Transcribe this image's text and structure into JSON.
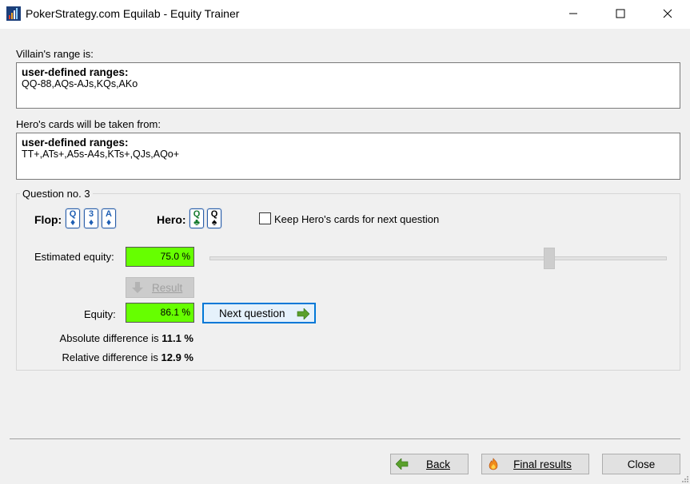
{
  "window": {
    "title": "PokerStrategy.com Equilab - Equity Trainer"
  },
  "villain": {
    "label": "Villain's range is:",
    "title": "user-defined ranges:",
    "value": "QQ-88,AQs-AJs,KQs,AKo"
  },
  "hero_range": {
    "label": "Hero's cards will be taken from:",
    "title": "user-defined ranges:",
    "value": "TT+,ATs+,A5s-A4s,KTs+,QJs,AQo+"
  },
  "question": {
    "legend": "Question no. 3",
    "flop_label": "Flop:",
    "flop_cards": [
      {
        "rank": "Q",
        "suit": "♦",
        "color": "#1f5fb4"
      },
      {
        "rank": "3",
        "suit": "♦",
        "color": "#1f5fb4"
      },
      {
        "rank": "A",
        "suit": "♦",
        "color": "#1f5fb4"
      }
    ],
    "hero_label": "Hero:",
    "hero_cards": [
      {
        "rank": "Q",
        "suit": "♣",
        "color": "#137a2c"
      },
      {
        "rank": "Q",
        "suit": "♠",
        "color": "#000000"
      }
    ],
    "keep_checkbox_label": "Keep Hero's cards for next question",
    "keep_checked": false,
    "estimated_label": "Estimated equity:",
    "estimated_value": "75.0 %",
    "slider_value_fraction": 0.75,
    "result_button": "Result",
    "equity_label": "Equity:",
    "equity_value": "86.1 %",
    "next_button": "Next question",
    "abs_diff_prefix": "Absolute difference is",
    "abs_diff_value": "11.1 %",
    "rel_diff_prefix": "Relative difference is",
    "rel_diff_value": "12.9 %"
  },
  "footer": {
    "back": "Back",
    "final_results": "Final results",
    "close": "Close"
  },
  "colors": {
    "equity_box": "#66ff00",
    "focus_border": "#0078d7",
    "arrow_green": "#5aa02c"
  }
}
